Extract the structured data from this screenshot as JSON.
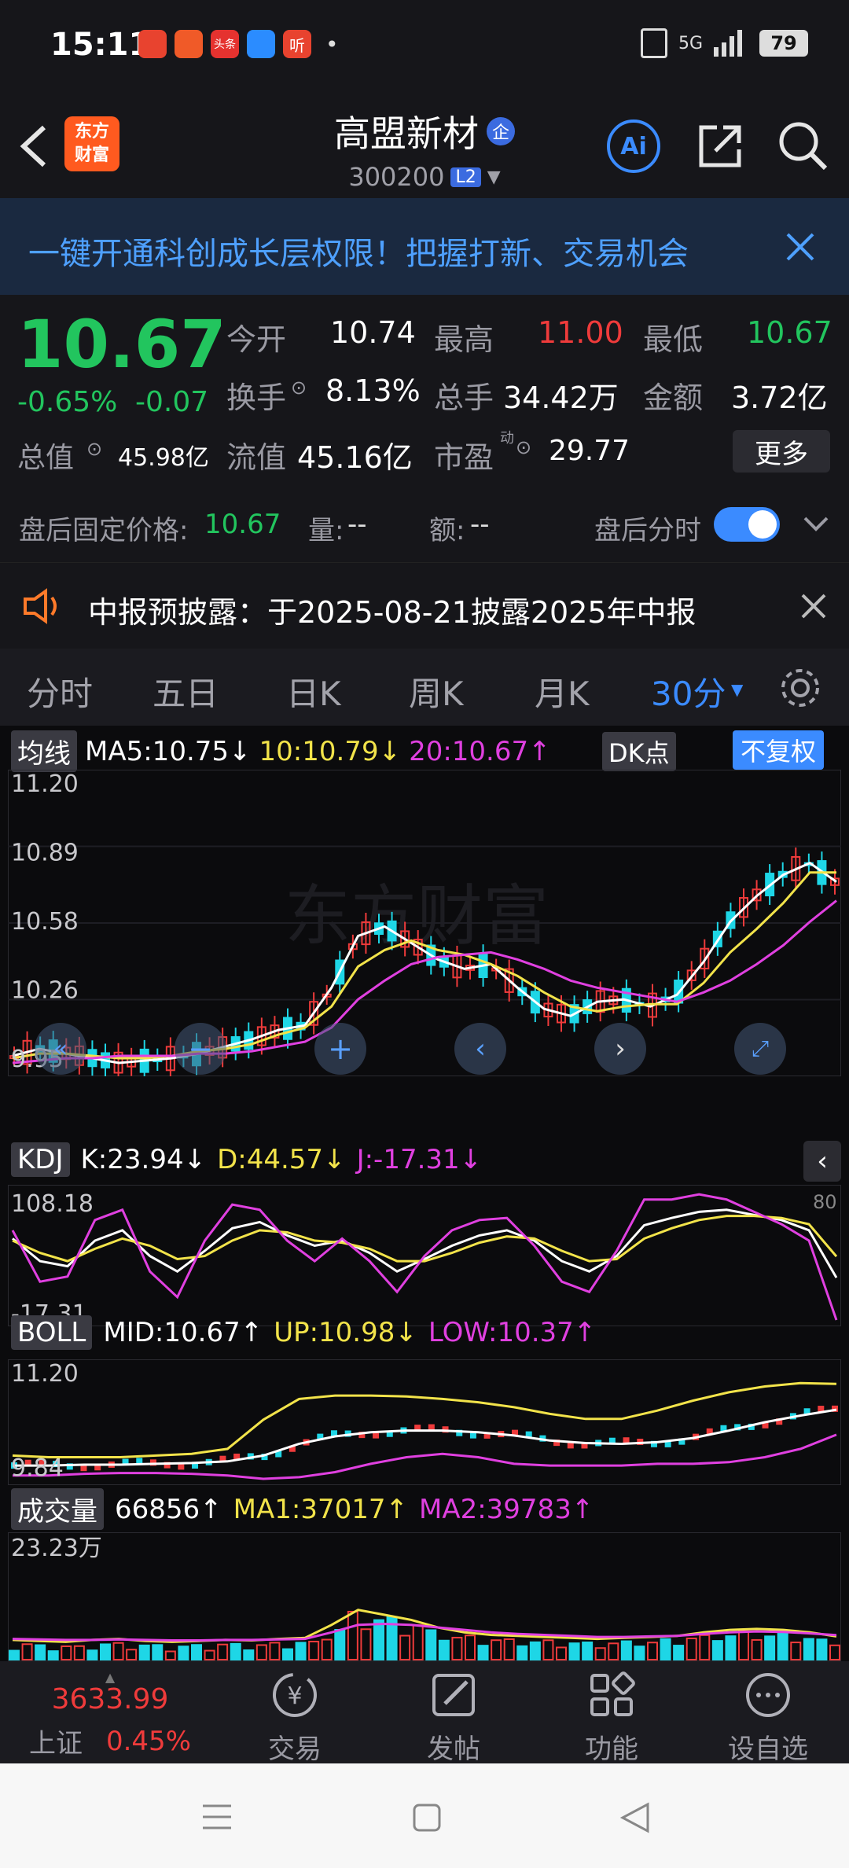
{
  "status_bar": {
    "time": "15:11",
    "app_icons": [
      "app-notif-icon-1",
      "app-notif-icon-2",
      "头条",
      "app-notif-icon-4",
      "听"
    ],
    "dot": "•",
    "network": "5G",
    "battery": "79"
  },
  "header": {
    "logo_line1": "东方",
    "logo_line2": "财富",
    "stock_name": "高盟新材",
    "enterprise_badge": "企",
    "stock_code": "300200",
    "level_badge": "L2",
    "ai_label": "Ai"
  },
  "banner": {
    "text": "一键开通科创成长层权限！把握打新、交易机会"
  },
  "quote": {
    "price": "10.67",
    "change_pct": "-0.65%",
    "change": "-0.07",
    "open_label": "今开",
    "open": "10.74",
    "high_label": "最高",
    "high": "11.00",
    "low_label": "最低",
    "low": "10.67",
    "turnover_label": "换手",
    "turnover": "8.13%",
    "volume_label": "总手",
    "volume": "34.42万",
    "amount_label": "金额",
    "amount": "3.72亿",
    "mcap_label": "总值",
    "mcap": "45.98亿",
    "float_label": "流值",
    "float_cap": "45.16亿",
    "pe_label": "市盈",
    "pe_sup": "动",
    "pe": "29.77",
    "more": "更多"
  },
  "after_hours": {
    "price_label": "盘后固定价格:",
    "price": "10.67",
    "vol_label": "量:",
    "vol": "--",
    "amt_label": "额:",
    "amt": "--",
    "toggle_label": "盘后分时"
  },
  "notice": {
    "text": "中报预披露：于2025-08-21披露2025年中报"
  },
  "tabs": {
    "items": [
      "分时",
      "五日",
      "日K",
      "周K",
      "月K",
      "30分"
    ],
    "active_index": 5
  },
  "chart_header": {
    "ma_select": "均线",
    "ma5": "MA5:10.75↓",
    "ma10": "10:10.79↓",
    "ma20": "20:10.67↑",
    "dk": "DK点",
    "fq": "不复权"
  },
  "chart_data": [
    {
      "type": "candlestick",
      "title": "",
      "y_labels": [
        "11.20",
        "10.89",
        "10.58",
        "10.26",
        "9.95"
      ],
      "ylim": [
        9.95,
        11.2
      ],
      "series": [
        {
          "name": "MA5",
          "values": [
            10.01,
            10.04,
            10.02,
            10.0,
            9.98,
            9.99,
            10.0,
            10.02,
            10.05,
            10.08,
            10.12,
            10.14,
            10.3,
            10.52,
            10.56,
            10.49,
            10.42,
            10.38,
            10.4,
            10.3,
            10.21,
            10.18,
            10.24,
            10.25,
            10.22,
            10.27,
            10.41,
            10.58,
            10.69,
            10.78,
            10.83,
            10.75
          ]
        },
        {
          "name": "10",
          "values": [
            10.0,
            10.02,
            10.02,
            10.01,
            10.0,
            10.0,
            10.01,
            10.03,
            10.04,
            10.06,
            10.1,
            10.13,
            10.22,
            10.39,
            10.46,
            10.5,
            10.46,
            10.44,
            10.4,
            10.35,
            10.28,
            10.22,
            10.2,
            10.22,
            10.23,
            10.23,
            10.32,
            10.45,
            10.55,
            10.66,
            10.79,
            10.79
          ]
        },
        {
          "name": "20",
          "values": [
            9.98,
            9.99,
            10.0,
            10.0,
            10.01,
            10.01,
            10.01,
            10.02,
            10.02,
            10.03,
            10.05,
            10.07,
            10.13,
            10.25,
            10.33,
            10.4,
            10.43,
            10.44,
            10.45,
            10.42,
            10.38,
            10.33,
            10.3,
            10.28,
            10.26,
            10.24,
            10.28,
            10.33,
            10.4,
            10.48,
            10.58,
            10.67
          ]
        }
      ]
    },
    {
      "type": "line",
      "title": "KDJ",
      "y_labels": [
        "108.18",
        "-17.31"
      ],
      "right_label": "80",
      "ylim": [
        -17.31,
        108.18
      ],
      "series": [
        {
          "name": "K",
          "values": [
            62,
            40,
            35,
            60,
            70,
            45,
            30,
            50,
            72,
            78,
            65,
            55,
            60,
            48,
            30,
            42,
            55,
            65,
            70,
            60,
            40,
            30,
            45,
            75,
            82,
            88,
            90,
            85,
            80,
            70,
            23.94
          ]
        },
        {
          "name": "D",
          "values": [
            60,
            48,
            40,
            52,
            62,
            55,
            42,
            45,
            60,
            70,
            68,
            60,
            58,
            52,
            40,
            40,
            48,
            58,
            64,
            62,
            50,
            40,
            42,
            62,
            72,
            80,
            84,
            84,
            82,
            76,
            44.57
          ]
        },
        {
          "name": "J",
          "values": [
            70,
            20,
            25,
            80,
            90,
            30,
            5,
            60,
            95,
            90,
            60,
            40,
            62,
            40,
            10,
            45,
            70,
            80,
            82,
            55,
            20,
            10,
            50,
            100,
            100,
            105,
            100,
            88,
            76,
            60,
            -17.31
          ]
        }
      ]
    },
    {
      "type": "line",
      "title": "BOLL",
      "y_labels": [
        "11.20",
        "9.84"
      ],
      "ylim": [
        9.84,
        11.2
      ],
      "series": [
        {
          "name": "MID",
          "values": [
            10.0,
            10.0,
            10.01,
            10.01,
            10.02,
            10.03,
            10.05,
            10.12,
            10.26,
            10.35,
            10.4,
            10.42,
            10.42,
            10.4,
            10.36,
            10.3,
            10.27,
            10.26,
            10.28,
            10.33,
            10.42,
            10.52,
            10.6,
            10.67
          ]
        },
        {
          "name": "UP",
          "values": [
            10.12,
            10.1,
            10.1,
            10.1,
            10.12,
            10.14,
            10.2,
            10.55,
            10.8,
            10.84,
            10.84,
            10.83,
            10.8,
            10.76,
            10.7,
            10.62,
            10.56,
            10.56,
            10.66,
            10.78,
            10.88,
            10.95,
            10.99,
            10.98
          ]
        },
        {
          "name": "LOW",
          "values": [
            9.88,
            9.88,
            9.9,
            9.91,
            9.91,
            9.9,
            9.88,
            9.84,
            9.86,
            9.92,
            10.02,
            10.1,
            10.14,
            10.1,
            10.02,
            10.0,
            10.0,
            10.0,
            10.02,
            10.02,
            10.04,
            10.1,
            10.2,
            10.37
          ]
        }
      ]
    },
    {
      "type": "bar",
      "title": "成交量",
      "y_labels": [
        "23.23万"
      ],
      "ylim": [
        0,
        232300
      ],
      "series": [
        {
          "name": "MA1",
          "values": [
            30000,
            28000,
            26000,
            30000,
            32000,
            28000,
            26000,
            28000,
            30000,
            29000,
            32000,
            34000,
            60000,
            90000,
            80000,
            70000,
            55000,
            45000,
            40000,
            38000,
            36000,
            34000,
            32000,
            34000,
            36000,
            38000,
            45000,
            50000,
            52000,
            50000,
            45000,
            37017
          ]
        },
        {
          "name": "MA2",
          "values": [
            32000,
            31000,
            30000,
            30000,
            31000,
            30000,
            29000,
            29000,
            30000,
            30000,
            31000,
            32000,
            45000,
            60000,
            62000,
            60000,
            55000,
            50000,
            45000,
            42000,
            40000,
            38000,
            36000,
            36000,
            37000,
            38000,
            42000,
            45000,
            47000,
            46000,
            43000,
            39783
          ]
        }
      ]
    }
  ],
  "indicators": {
    "kdj": {
      "select": "KDJ",
      "k": "K:23.94↓",
      "d": "D:44.57↓",
      "j": "J:-17.31↓"
    },
    "boll": {
      "select": "BOLL",
      "mid": "MID:10.67↑",
      "up": "UP:10.98↓",
      "low": "LOW:10.37↑"
    },
    "vol": {
      "select": "成交量",
      "value": "66856↑",
      "ma1": "MA1:37017↑",
      "ma2": "MA2:39783↑"
    }
  },
  "bottom_nav": {
    "index_value": "3633.99",
    "index_name": "上证",
    "index_change": "0.45%",
    "items": [
      "交易",
      "发帖",
      "功能",
      "设自选"
    ]
  },
  "colors": {
    "up": "#ef3b3b",
    "down": "#22c55e",
    "accent": "#3b8bff",
    "ma5": "#ffffff",
    "ma10": "#f2e34a",
    "ma20": "#e040e0"
  }
}
